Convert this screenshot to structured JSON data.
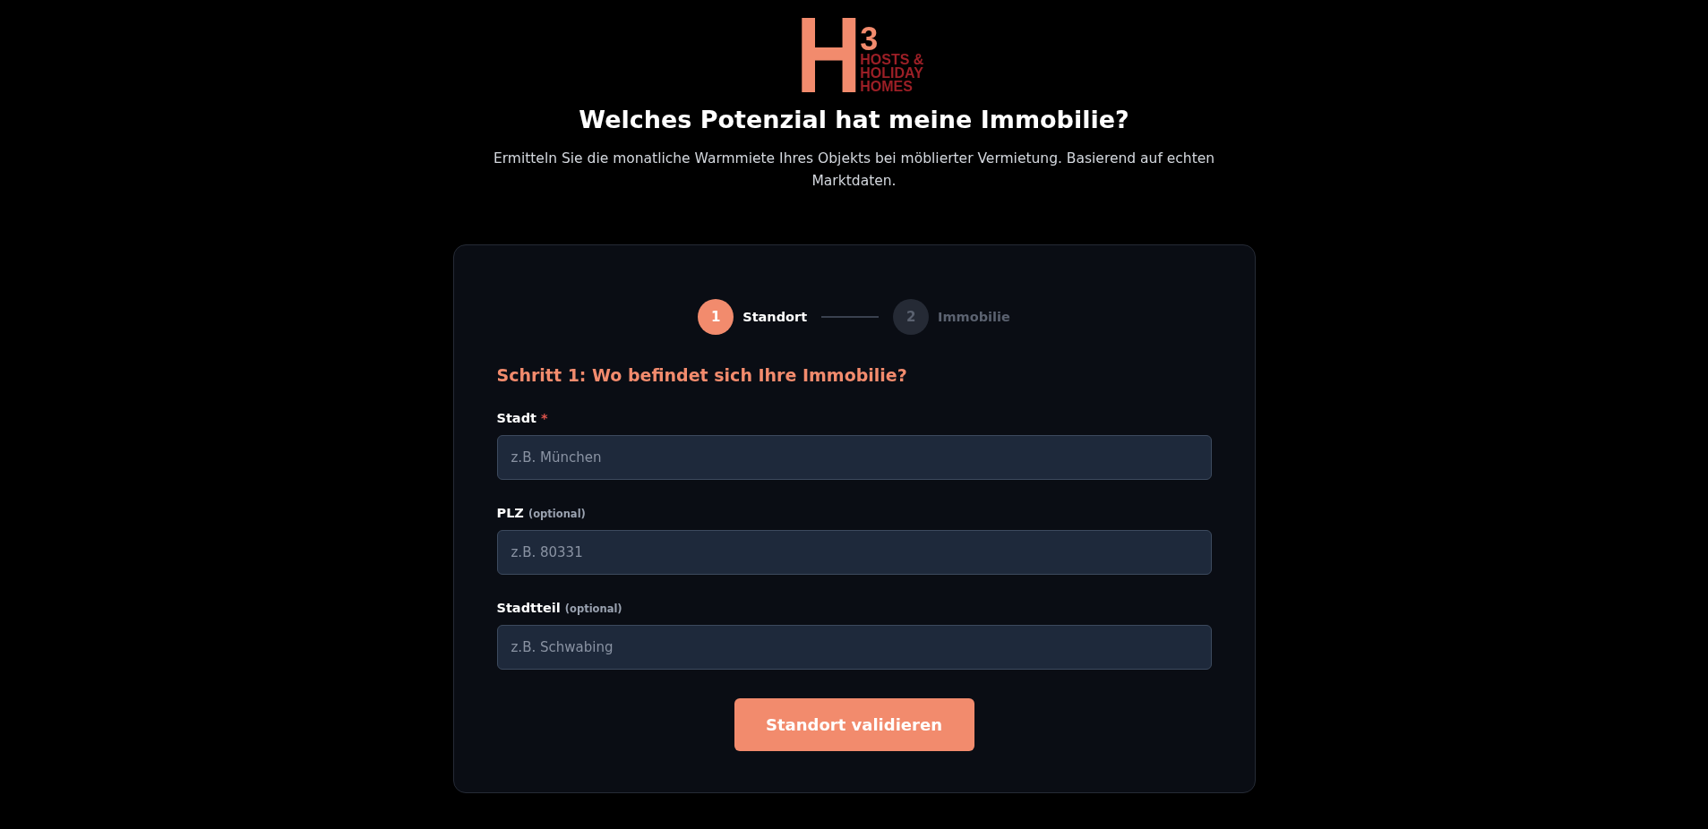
{
  "logo": {
    "letter": "H",
    "superscript": "3",
    "lines": [
      "HOSTS &",
      "HOLIDAY",
      "HOMES"
    ]
  },
  "title": "Welches Potenzial hat meine Immobilie?",
  "subtitle": "Ermitteln Sie die monatliche Warmmiete Ihres Objekts bei möblierter Vermietung. Basierend auf echten Marktdaten.",
  "steps": [
    {
      "number": "1",
      "label": "Standort",
      "selected": true
    },
    {
      "number": "2",
      "label": "Immobilie",
      "selected": false
    }
  ],
  "step_heading": "Schritt 1: Wo befindet sich Ihre Immobilie?",
  "fields": [
    {
      "label": "Stadt",
      "required": true,
      "placeholder": "z.B. München"
    },
    {
      "label": "PLZ",
      "note": "(optional)",
      "required": false,
      "placeholder": "z.B. 80331"
    },
    {
      "label": "Stadtteil",
      "note": "(optional)",
      "required": false,
      "placeholder": "z.B. Schwabing"
    }
  ],
  "required_mark": "*",
  "submit": "Standort validieren"
}
